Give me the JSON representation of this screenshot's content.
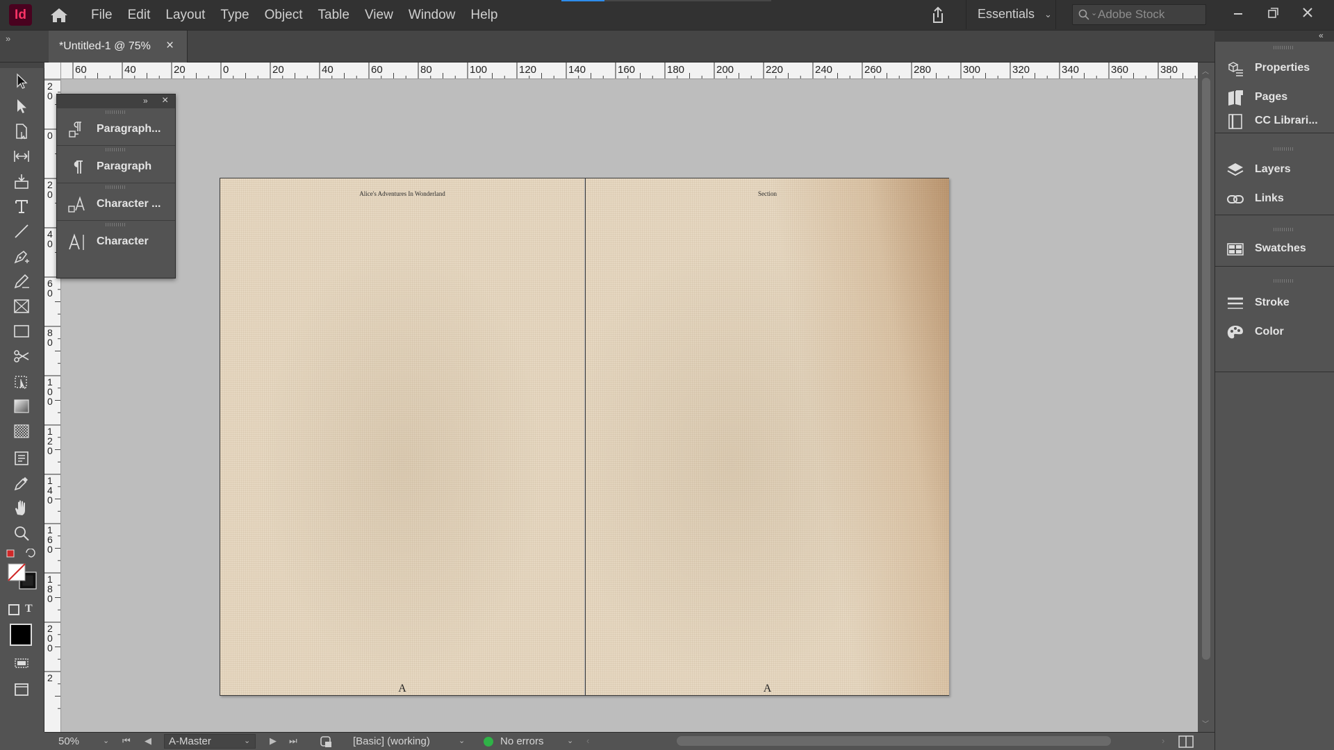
{
  "app": {
    "logo": "Id",
    "colors": {
      "accent": "#2d8ceb",
      "logo_bg": "#49021f",
      "logo_fg": "#ff3366",
      "status_ok": "#2fb347"
    }
  },
  "menu": [
    "File",
    "Edit",
    "Layout",
    "Type",
    "Object",
    "Table",
    "View",
    "Window",
    "Help"
  ],
  "workspace": {
    "label": "Essentials"
  },
  "search": {
    "placeholder": "Adobe Stock"
  },
  "document": {
    "tab_title": "*Untitled-1 @ 75%",
    "close_glyph": "×"
  },
  "rulers": {
    "horizontal": [
      "60",
      "40",
      "20",
      "0",
      "20",
      "40",
      "60",
      "80",
      "100",
      "120",
      "140",
      "160",
      "180",
      "200",
      "220",
      "240",
      "260",
      "280",
      "300",
      "320",
      "340",
      "360",
      "380"
    ],
    "vertical": [
      "2\n0",
      "0",
      "2\n0",
      "4\n0",
      "6\n0",
      "8\n0",
      "1\n0\n0",
      "1\n2\n0",
      "1\n4\n0",
      "1\n6\n0",
      "1\n8\n0",
      "2\n0\n0",
      "2"
    ]
  },
  "spread": {
    "left_page": {
      "running_head": "Alice's Adventures In Wonderland",
      "folio": "A"
    },
    "right_page": {
      "running_head": "Section",
      "folio": "A"
    }
  },
  "tools": [
    "selection-tool",
    "direct-selection-tool",
    "page-tool",
    "gap-tool",
    "content-collector-tool",
    "type-tool",
    "line-tool",
    "pen-tool",
    "pencil-tool",
    "rectangle-frame-tool",
    "rectangle-tool",
    "scissors-tool",
    "free-transform-tool",
    "gradient-swatch-tool",
    "gradient-feather-tool",
    "note-tool",
    "eyedropper-tool",
    "hand-tool",
    "zoom-tool"
  ],
  "floating_panel": {
    "items": [
      {
        "label": "Paragraph...",
        "icon": "paragraph-styles-icon"
      },
      {
        "label": "Paragraph",
        "icon": "paragraph-icon"
      },
      {
        "label": "Character ...",
        "icon": "character-styles-icon"
      },
      {
        "label": "Character",
        "icon": "character-icon"
      }
    ]
  },
  "dock": {
    "groups": [
      [
        {
          "label": "Properties",
          "icon": "properties-icon"
        },
        {
          "label": "Pages",
          "icon": "pages-icon"
        },
        {
          "label": "CC Librari...",
          "icon": "cc-libraries-icon"
        }
      ],
      [
        {
          "label": "Layers",
          "icon": "layers-icon"
        },
        {
          "label": "Links",
          "icon": "links-icon"
        }
      ],
      [
        {
          "label": "Swatches",
          "icon": "swatches-icon"
        }
      ],
      [
        {
          "label": "Stroke",
          "icon": "stroke-icon"
        },
        {
          "label": "Color",
          "icon": "color-icon"
        }
      ]
    ]
  },
  "status": {
    "zoom": "50%",
    "page": "A-Master",
    "style": "[Basic] (working)",
    "preflight": "No errors"
  }
}
